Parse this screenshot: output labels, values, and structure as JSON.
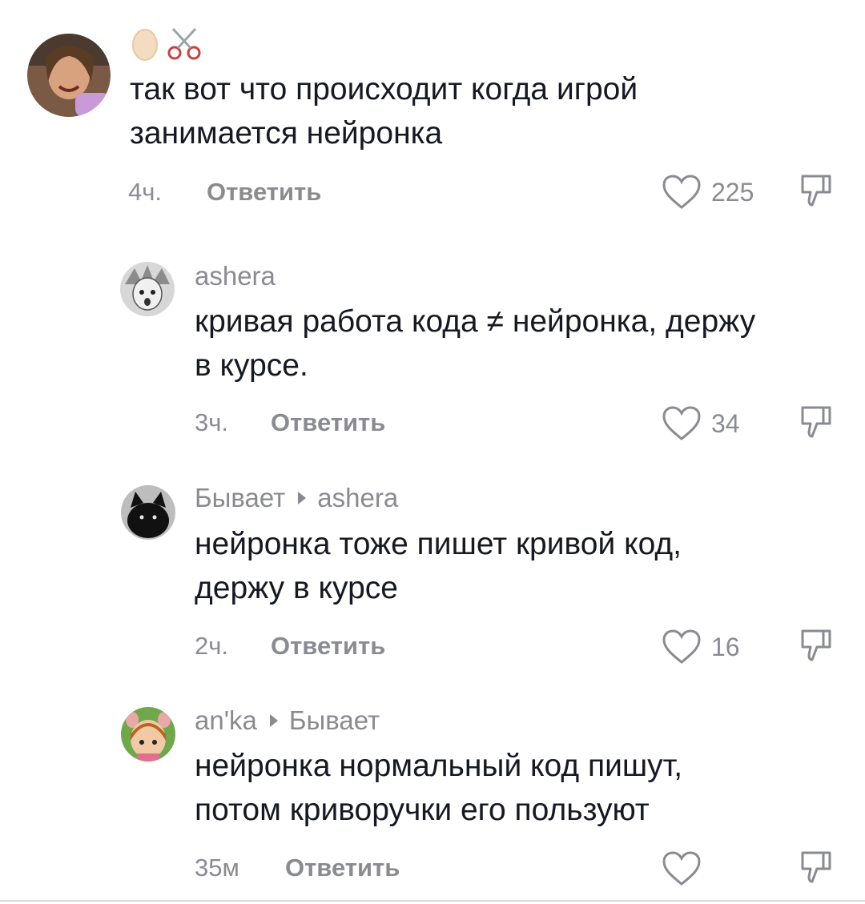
{
  "comments": [
    {
      "username": "",
      "username_emoji": [
        "egg-icon",
        "scissors-icon"
      ],
      "text": "так вот что происходит когда игрой\nзанимается нейронка",
      "time": "4ч.",
      "reply_label": "Ответить",
      "likes": "225"
    },
    {
      "username": "ashera",
      "text": "кривая работа кода ≠ нейронка, держу\nв курсе.",
      "time": "3ч.",
      "reply_label": "Ответить",
      "likes": "34"
    },
    {
      "username": "Бывает",
      "reply_to": "ashera",
      "text": "нейронка тоже пишет кривой код,\nдержу в курсе",
      "time": "2ч.",
      "reply_label": "Ответить",
      "likes": "16"
    },
    {
      "username": "an'ka",
      "reply_to": "Бывает",
      "text": "нейронка нормальный код пишут,\nпотом криворучки его пользуют",
      "time": "35м",
      "reply_label": "Ответить",
      "likes": ""
    }
  ],
  "colors": {
    "text": "#161823",
    "muted": "#8a8b91",
    "background": "#ffffff"
  }
}
